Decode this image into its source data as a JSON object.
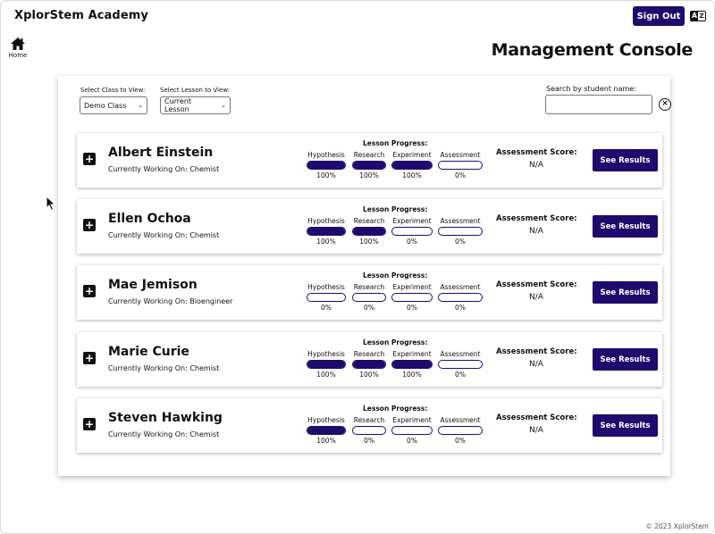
{
  "header": {
    "brand": "XplorStem Academy",
    "signout_label": "Sign Out",
    "translate_icon": "translate-icon"
  },
  "nav": {
    "home_label": "Home",
    "home_icon": "home-icon"
  },
  "page": {
    "title": "Management Console"
  },
  "filters": {
    "class_label": "Select Class to View:",
    "class_value": "Demo Class",
    "lesson_label": "Select Lesson to View:",
    "lesson_value": "Current Lesson",
    "search_label": "Search by student name:",
    "search_value": ""
  },
  "labels": {
    "lesson_progress": "Lesson Progress:",
    "assessment_score": "Assessment Score:",
    "see_results": "See Results",
    "stages": [
      "Hypothesis",
      "Research",
      "Experiment",
      "Assessment"
    ]
  },
  "students": [
    {
      "name": "Albert Einstein",
      "working": "Currently Working On: Chemist",
      "progress": [
        100,
        100,
        100,
        0
      ],
      "progress_text": [
        "100%",
        "100%",
        "100%",
        "0%"
      ],
      "score": "N/A"
    },
    {
      "name": "Ellen Ochoa",
      "working": "Currently Working On: Chemist",
      "progress": [
        100,
        100,
        0,
        0
      ],
      "progress_text": [
        "100%",
        "100%",
        "0%",
        "0%"
      ],
      "score": "N/A"
    },
    {
      "name": "Mae Jemison",
      "working": "Currently Working On: Bioengineer",
      "progress": [
        0,
        0,
        0,
        0
      ],
      "progress_text": [
        "0%",
        "0%",
        "0%",
        "0%"
      ],
      "score": "N/A"
    },
    {
      "name": "Marie Curie",
      "working": "Currently Working On: Chemist",
      "progress": [
        100,
        100,
        100,
        0
      ],
      "progress_text": [
        "100%",
        "100%",
        "100%",
        "0%"
      ],
      "score": "N/A"
    },
    {
      "name": "Steven Hawking",
      "working": "Currently Working On: Chemist",
      "progress": [
        100,
        0,
        0,
        0
      ],
      "progress_text": [
        "100%",
        "0%",
        "0%",
        "0%"
      ],
      "score": "N/A"
    }
  ],
  "footer": {
    "copyright": "© 2023 XplorStem"
  },
  "colors": {
    "accent": "#1f0a6e"
  }
}
